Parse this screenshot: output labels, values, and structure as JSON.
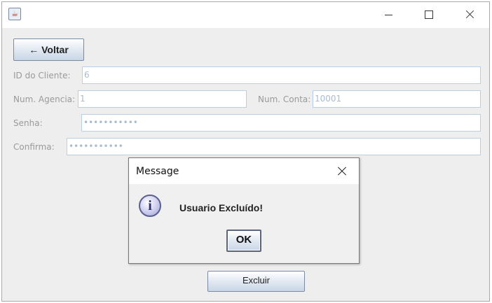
{
  "window": {
    "app_icon": "java-cup-icon"
  },
  "toolbar": {
    "back_label": "← Voltar"
  },
  "form": {
    "client_id": {
      "label": "ID do Cliente:",
      "value": "6"
    },
    "agency": {
      "label": "Num. Agencia:",
      "value": "1"
    },
    "account": {
      "label": "Num. Conta:",
      "value": "10001"
    },
    "password": {
      "label": "Senha:",
      "value": "•••••••••••"
    },
    "confirm": {
      "label": "Confirma:",
      "value": "•••••••••••"
    },
    "delete_label": "Excluir"
  },
  "dialog": {
    "title": "Message",
    "icon": "info-icon",
    "message": "Usuario Excluído!",
    "ok_label": "OK"
  },
  "colors": {
    "panel_bg": "#eeeeee",
    "field_border": "#b8cfe5",
    "disabled_text": "#9a9a9a"
  }
}
